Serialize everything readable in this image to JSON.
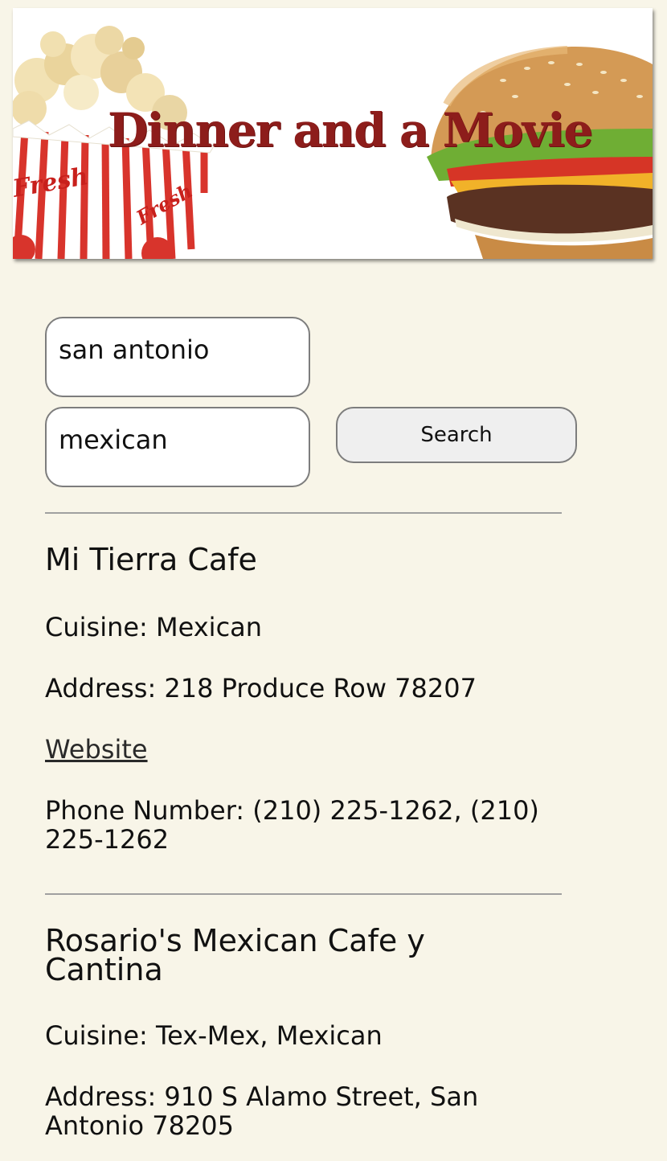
{
  "banner": {
    "title": "Dinner and a Movie",
    "popcorn_text": [
      "Fresh",
      "Fresh"
    ]
  },
  "search": {
    "city_value": "san antonio",
    "cuisine_value": "mexican",
    "button_label": "Search"
  },
  "results": [
    {
      "name": "Mi Tierra Cafe",
      "cuisine": "Cuisine: Mexican",
      "address": "Address: 218 Produce Row 78207",
      "website_label": "Website",
      "phone": "Phone Number: (210) 225-1262, (210) 225-1262"
    },
    {
      "name": "Rosario's Mexican Cafe y Cantina",
      "cuisine": "Cuisine: Tex-Mex, Mexican",
      "address": "Address: 910 S Alamo Street, San Antonio 78205"
    }
  ],
  "colors": {
    "page_background": "#f8f5e8",
    "title_red": "#8d1d1b",
    "button_background": "#efefef"
  }
}
